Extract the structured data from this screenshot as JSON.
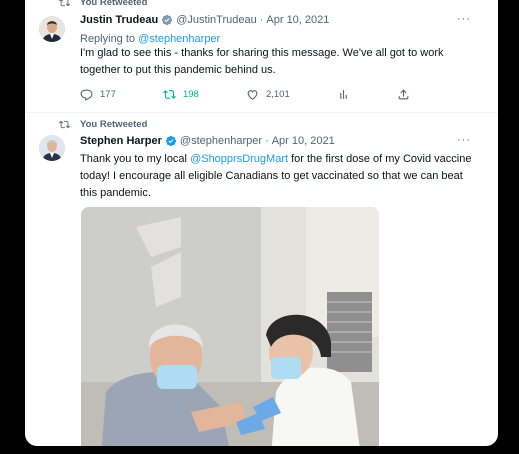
{
  "tweet1": {
    "retweet_label": "You Retweeted",
    "name": "Justin Trudeau",
    "handle": "@JustinTrudeau",
    "dot": "·",
    "date": "Apr 10, 2021",
    "replying_prefix": "Replying to",
    "replying_handle": "@stephenharper",
    "text": "I'm glad to see this - thanks for sharing this message. We've all got to work together to put this pandemic behind us.",
    "replies": "177",
    "retweets": "198",
    "likes": "2,101",
    "more": "···"
  },
  "tweet2": {
    "retweet_label": "You Retweeted",
    "name": "Stephen Harper",
    "handle": "@stephenharper",
    "dot": "·",
    "date": "Apr 10, 2021",
    "text_before": "Thank you to my local ",
    "text_mention": "@ShopprsDrugMart",
    "text_after": " for the first dose of my Covid vaccine today! I encourage all eligible Canadians to get vaccinated so that we can beat this pandemic.",
    "more": "···"
  },
  "colors": {
    "accent": "#1d9bf0",
    "retweet_green": "#00ba7c",
    "muted": "#536471"
  },
  "icons": [
    "retweet-icon",
    "verified-badge-icon",
    "reply-icon",
    "like-icon",
    "analytics-icon",
    "share-icon",
    "more-icon"
  ]
}
